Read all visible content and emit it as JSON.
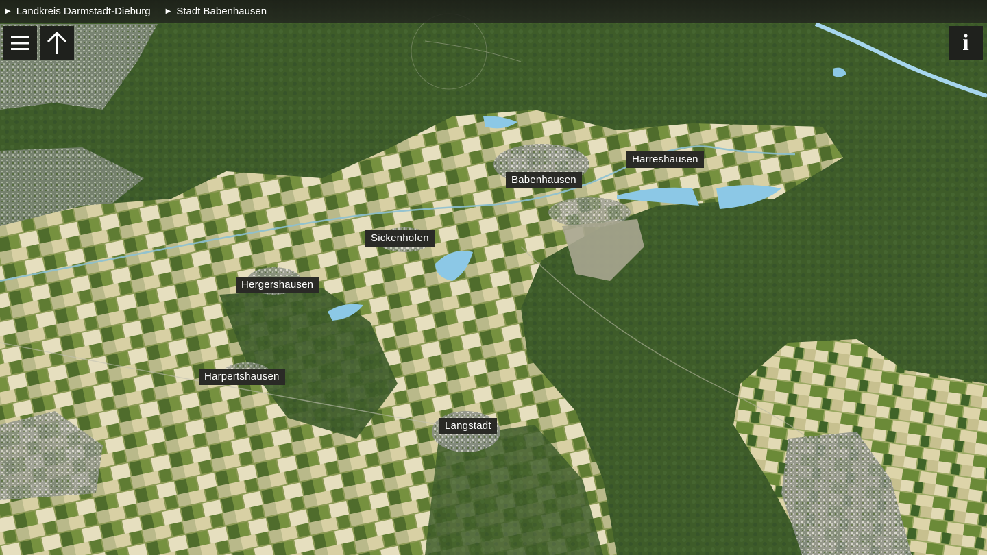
{
  "breadcrumb": [
    {
      "label": "Landkreis Darmstadt-Dieburg"
    },
    {
      "label": "Stadt Babenhausen"
    }
  ],
  "controls": {
    "menu_icon": "hamburger-menu-icon",
    "up_icon": "arrow-up-icon",
    "info_label": "i"
  },
  "places": {
    "harreshausen": "Harreshausen",
    "babenhausen": "Babenhausen",
    "sickenhofen": "Sickenhofen",
    "hergershausen": "Hergershausen",
    "harpertshausen": "Harpertshausen",
    "langstadt": "Langstadt"
  },
  "colors": {
    "forest": "#3d5b28",
    "field_light": "#d9d2a8",
    "water": "#8cc8e6",
    "label_bg": "#2a2a26"
  }
}
